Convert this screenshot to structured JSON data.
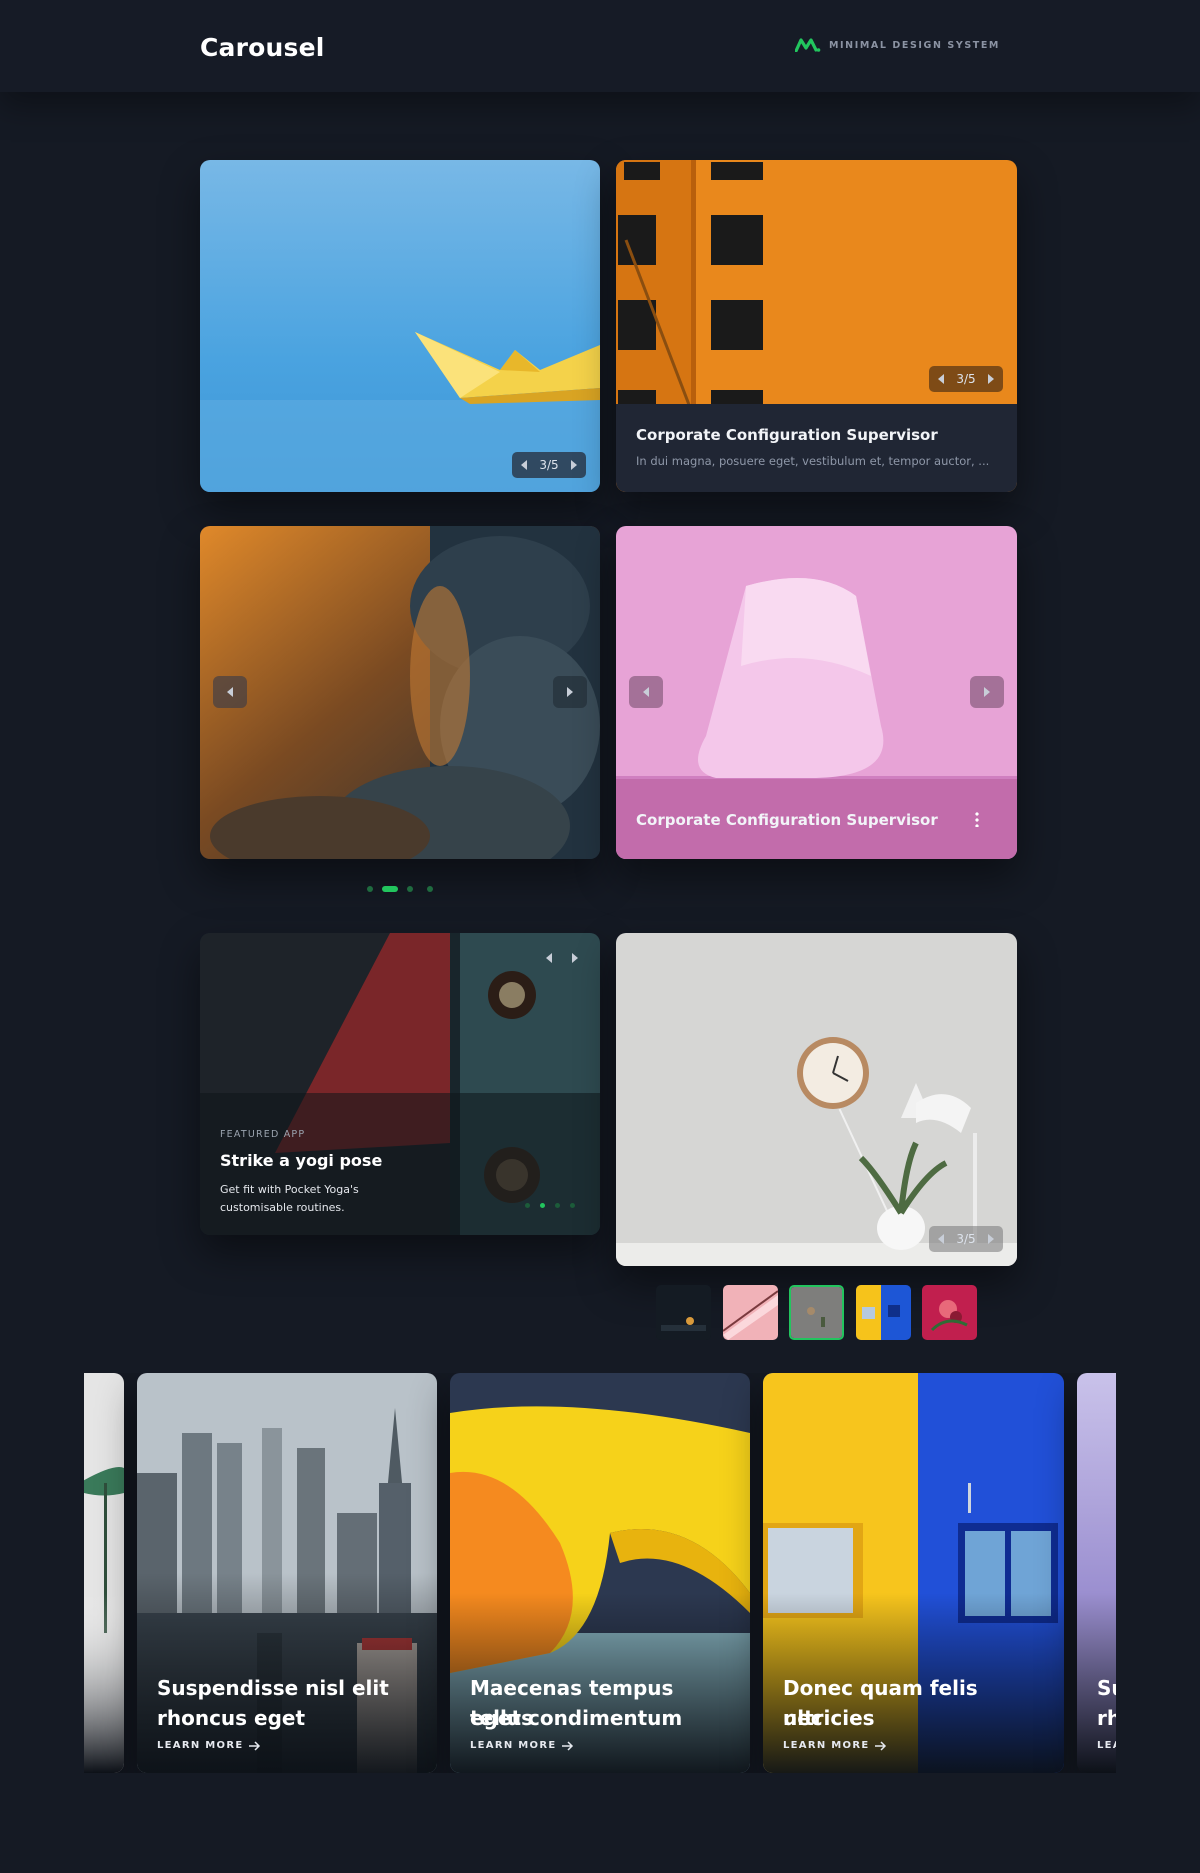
{
  "header": {
    "title": "Carousel",
    "brand_text": "MINIMAL DESIGN SYSTEM",
    "brand_color": "#22c55e"
  },
  "carousel_1": {
    "counter": "3/5"
  },
  "carousel_2": {
    "counter": "3/5",
    "title": "Corporate Configuration Supervisor",
    "description": "In dui magna, posuere eget, vestibulum et, tempor auctor, ..."
  },
  "carousel_3": {
    "dots": 4,
    "active_dot": 1,
    "dot_color": "#22c55e"
  },
  "carousel_4": {
    "title": "Corporate Configuration Supervisor"
  },
  "carousel_5": {
    "eyebrow": "FEATURED APP",
    "title": "Strike a yogi pose",
    "description_line1": "Get fit with Pocket Yoga's",
    "description_line2": "customisable routines."
  },
  "carousel_6": {
    "counter": "3/5",
    "thumbnails": [
      "night-room",
      "pink-abstract",
      "grey-clock",
      "yellow-blue-building",
      "red-flowers"
    ],
    "active_thumbnail": 2
  },
  "slider": {
    "slides": [
      {
        "title": "",
        "learn_more": ""
      },
      {
        "title_line1": "Suspendisse nisl elit",
        "title_line2": "rhoncus eget",
        "learn_more": "LEARN MORE"
      },
      {
        "title_line1": "Maecenas tempus tellus",
        "title_line2": "eget condimentum",
        "learn_more": "LEARN MORE"
      },
      {
        "title_line1": "Donec quam felis ultricies",
        "title_line2": "nec",
        "learn_more": "LEARN MORE"
      },
      {
        "title_line1": "Su",
        "title_line2": "rh",
        "learn_more": "LEA"
      }
    ]
  }
}
